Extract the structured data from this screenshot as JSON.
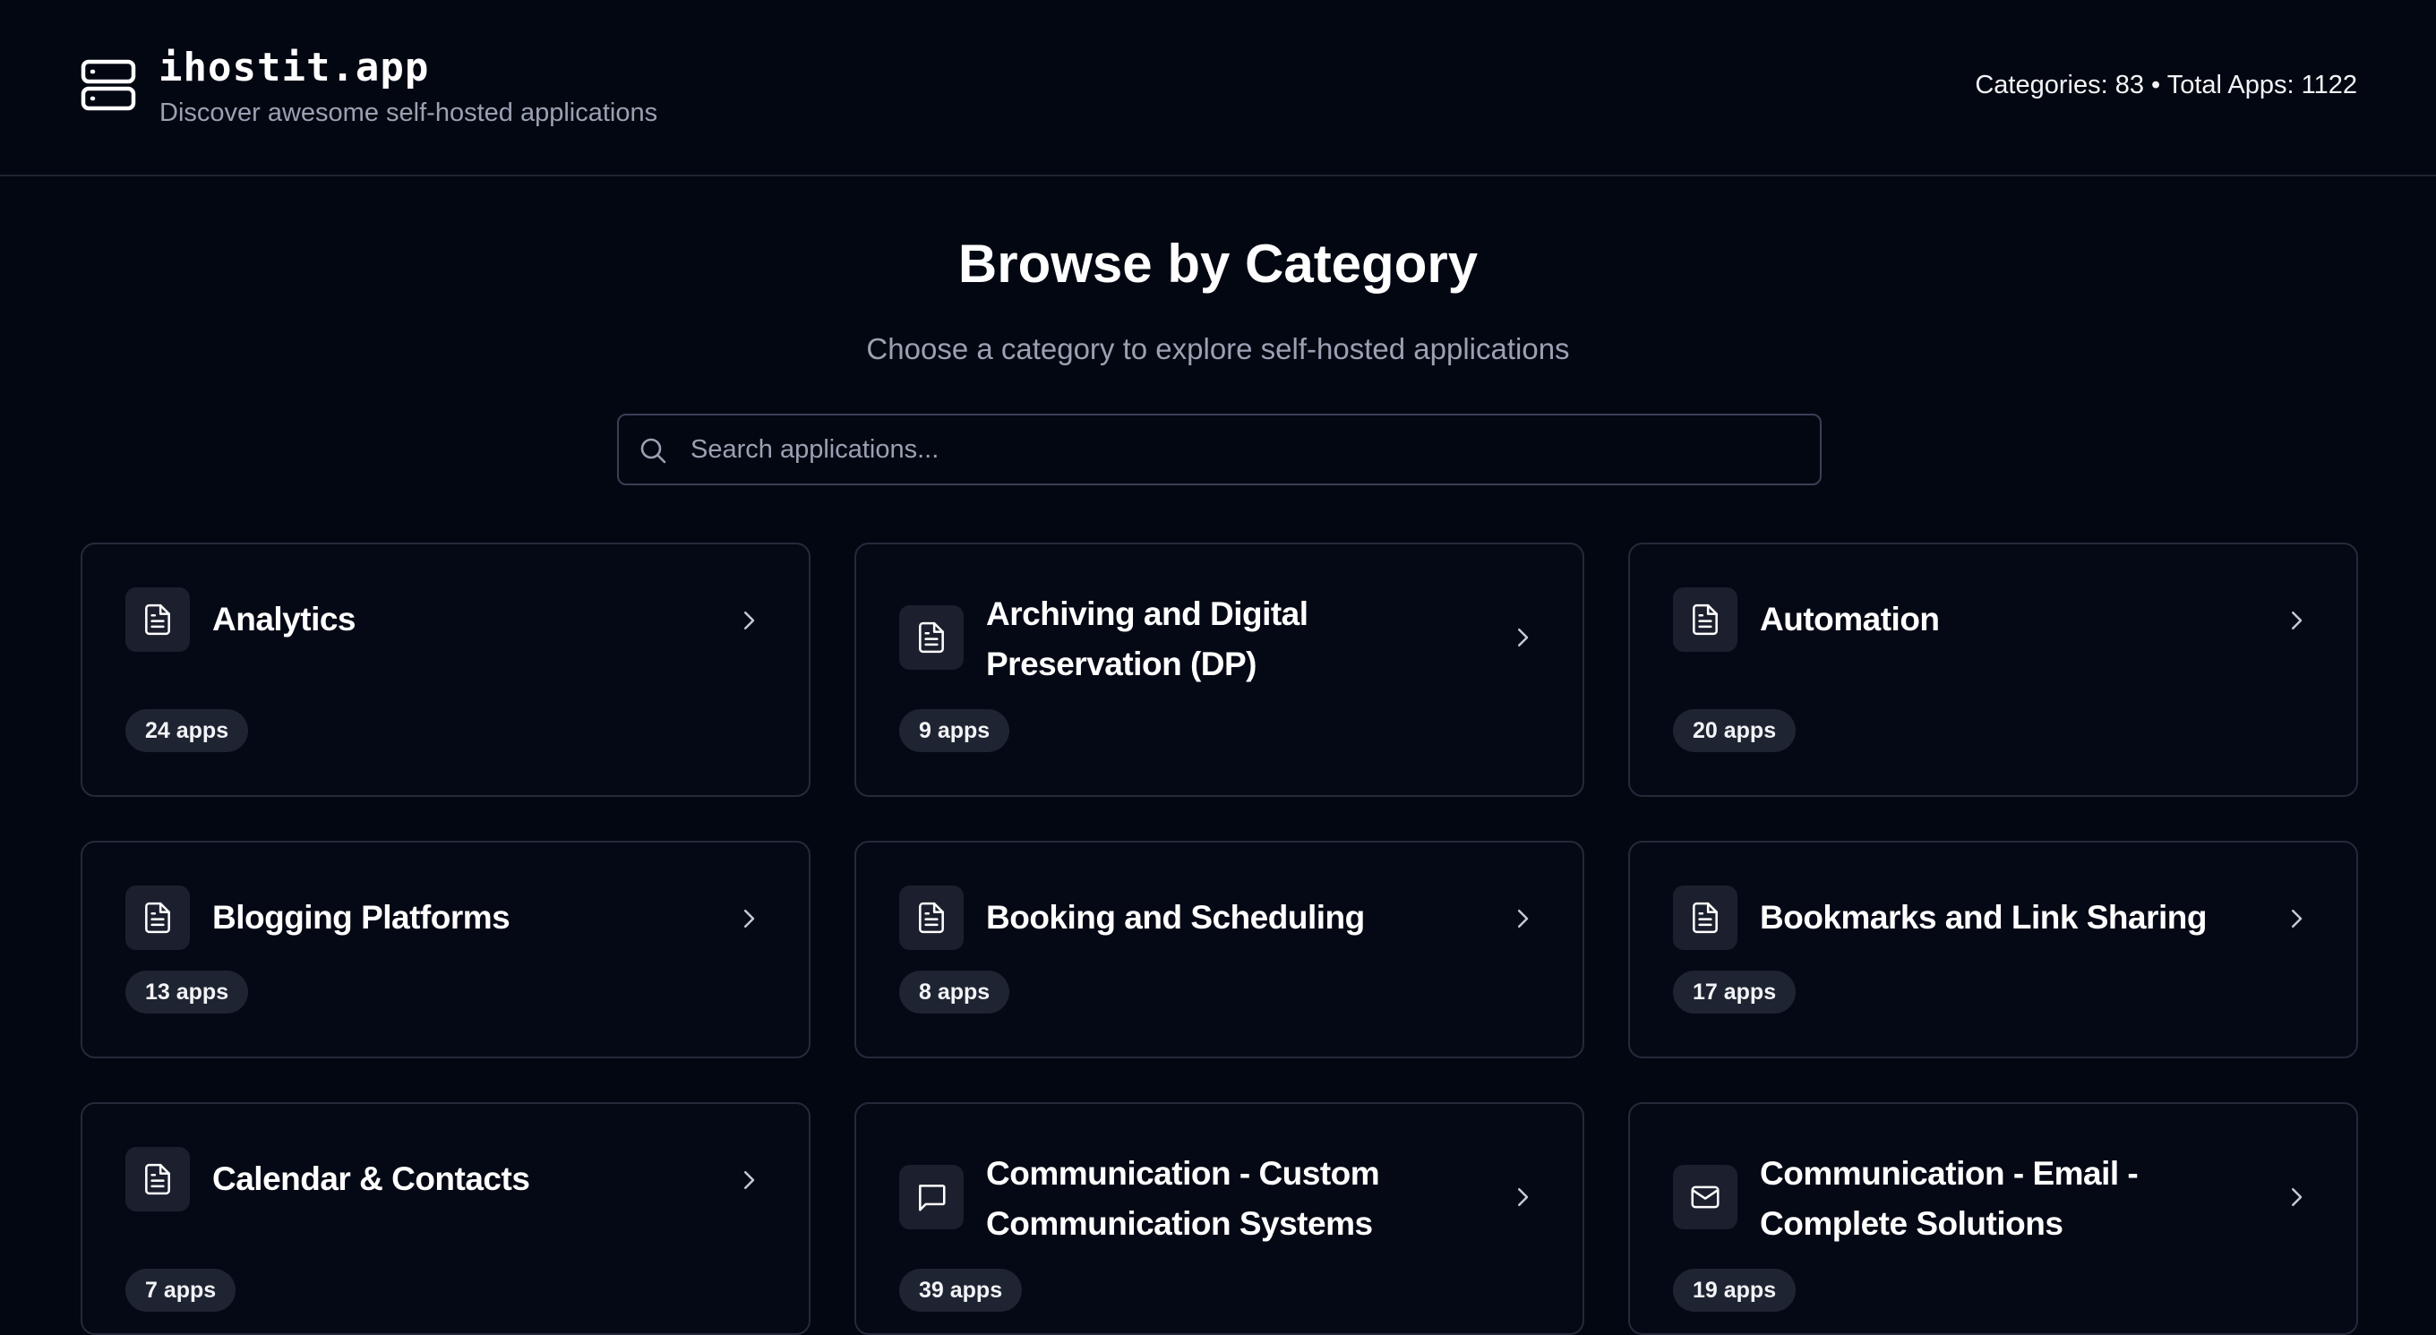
{
  "header": {
    "brand_title": "ihostit.app",
    "brand_tagline": "Discover awesome self-hosted applications",
    "logo_icon": "server-stack-icon",
    "stats": "Categories: 83 • Total Apps: 1122"
  },
  "main": {
    "title": "Browse by Category",
    "subtitle": "Choose a category to explore self-hosted applications"
  },
  "search": {
    "placeholder": "Search applications...",
    "value": "",
    "icon": "search-icon"
  },
  "categories": [
    {
      "title": "Analytics",
      "count": "24 apps",
      "icon": "document-icon"
    },
    {
      "title": "Archiving and Digital Preservation (DP)",
      "count": "9 apps",
      "icon": "document-icon"
    },
    {
      "title": "Automation",
      "count": "20 apps",
      "icon": "document-icon"
    },
    {
      "title": "Blogging Platforms",
      "count": "13 apps",
      "icon": "document-icon"
    },
    {
      "title": "Booking and Scheduling",
      "count": "8 apps",
      "icon": "document-icon"
    },
    {
      "title": "Bookmarks and Link Sharing",
      "count": "17 apps",
      "icon": "document-icon"
    },
    {
      "title": "Calendar & Contacts",
      "count": "7 apps",
      "icon": "document-icon"
    },
    {
      "title": "Communication - Custom Communication Systems",
      "count": "39 apps",
      "icon": "chat-bubble-icon"
    },
    {
      "title": "Communication - Email - Complete Solutions",
      "count": "19 apps",
      "icon": "mail-icon"
    }
  ],
  "colors": {
    "background": "#030712",
    "card_border": "#252a3a",
    "badge_bg": "#1f2433",
    "muted_text": "#9aa1b2"
  }
}
